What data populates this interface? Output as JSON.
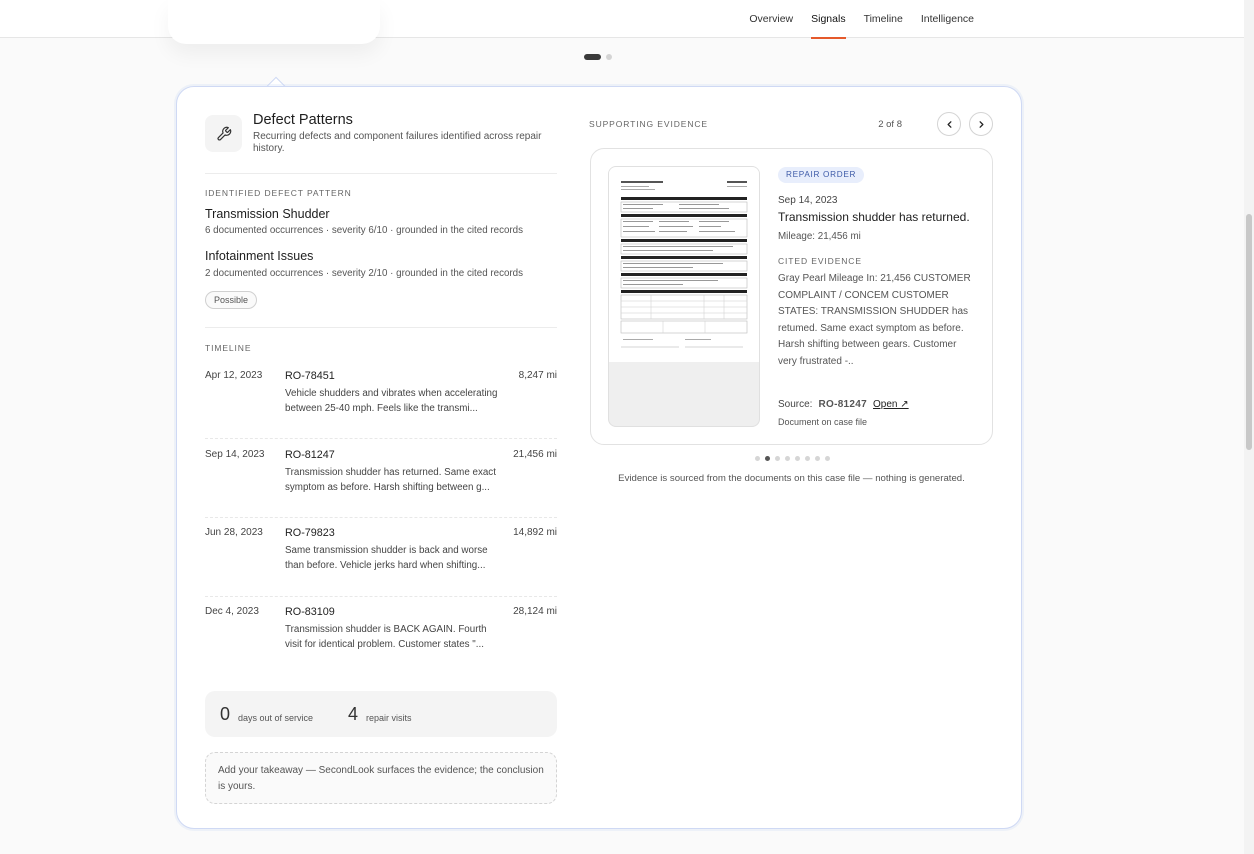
{
  "nav": {
    "tabs": [
      {
        "label": "Overview",
        "active": false
      },
      {
        "label": "Signals",
        "active": true
      },
      {
        "label": "Timeline",
        "active": false
      },
      {
        "label": "Intelligence",
        "active": false
      }
    ],
    "accent_color": "#e5592b"
  },
  "header": {
    "icon": "wrench-icon",
    "title": "Defect Patterns",
    "subtitle": "Recurring defects and component failures identified across repair history."
  },
  "patterns": {
    "label": "IDENTIFIED DEFECT PATTERN",
    "items": [
      {
        "name": "Transmission Shudder",
        "meta": "6 documented occurrences · severity 6/10 · grounded in the cited records"
      },
      {
        "name": "Infotainment Issues",
        "meta": "2 documented occurrences · severity 2/10 · grounded in the cited records"
      }
    ],
    "confidence_pill": "Possible"
  },
  "timeline": {
    "label": "TIMELINE",
    "rows": [
      {
        "date": "Apr 12, 2023",
        "ro": "RO-78451",
        "desc": "Vehicle shudders and vibrates when accelerating between 25-40 mph. Feels like the transmi...",
        "miles": "8,247 mi"
      },
      {
        "date": "Sep 14, 2023",
        "ro": "RO-81247",
        "desc": "Transmission shudder has returned. Same exact symptom as before. Harsh shifting between g...",
        "miles": "21,456 mi"
      },
      {
        "date": "Jun 28, 2023",
        "ro": "RO-79823",
        "desc": "Same transmission shudder is back and worse than before. Vehicle jerks hard when shifting...",
        "miles": "14,892 mi"
      },
      {
        "date": "Dec 4, 2023",
        "ro": "RO-83109",
        "desc": "Transmission shudder is BACK AGAIN. Fourth visit for identical problem. Customer states \"...",
        "miles": "28,124 mi"
      }
    ]
  },
  "stats": {
    "days_out": "0",
    "days_out_label": "days out of service",
    "visits": "4",
    "visits_label": "repair visits"
  },
  "takeaway": {
    "placeholder": "Add your takeaway — SecondLook surfaces the evidence; the conclusion is yours."
  },
  "evidence": {
    "label": "SUPPORTING EVIDENCE",
    "counter": "2 of 8",
    "badge": "REPAIR ORDER",
    "date": "Sep 14, 2023",
    "title": "Transmission shudder has returned.",
    "mileage": "Mileage: 21,456 mi",
    "cited_label": "CITED EVIDENCE",
    "cited_text": "Gray Pearl Mileage In: 21,456 CUSTOMER COMPLAINT / CONCEM CUSTOMER STATES: TRANSMISSION SHUDDER has retumed. Same exact symptom as before. Harsh shifting between gears. Customer very frustrated -..",
    "source_label": "Source:",
    "source_ro": "RO-81247",
    "open_label": "Open ↗",
    "doc_note": "Document on case file",
    "dots_total": 8,
    "dots_active": 2,
    "footnote": "Evidence is sourced from the documents on this case file — nothing is generated."
  }
}
